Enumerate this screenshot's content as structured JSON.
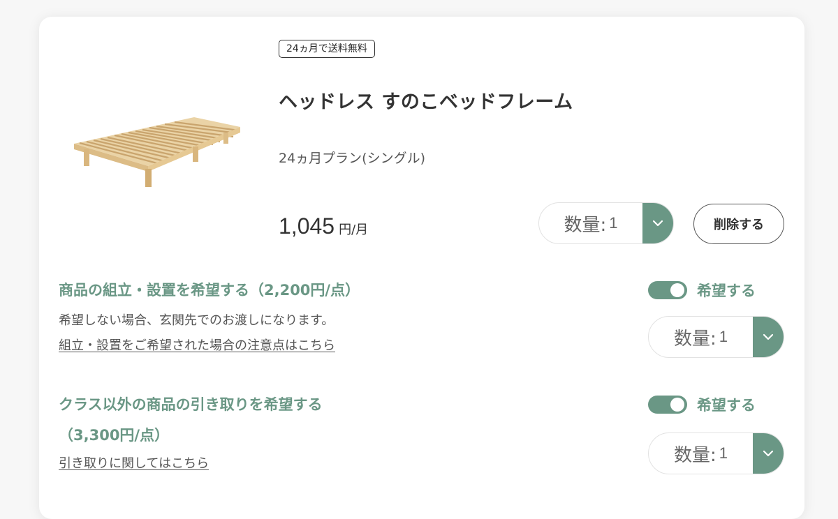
{
  "product": {
    "badge": "24ヵ月で送料無料",
    "name": "ヘッドレス すのこベッドフレーム",
    "plan": "24ヵ月プラン(シングル)",
    "price": "1,045",
    "price_unit": "円/月",
    "quantity_label": "数量:",
    "quantity_value": "1",
    "delete_label": "削除する"
  },
  "options": [
    {
      "title": "商品の組立・設置を希望する（2,200円/点）",
      "description": "希望しない場合、玄関先でのお渡しになります。",
      "link": "組立・設置をご希望された場合の注意点はこちら",
      "toggle_label": "希望する",
      "toggle_on": true,
      "quantity_label": "数量:",
      "quantity_value": "1"
    },
    {
      "title": "クラス以外の商品の引き取りを希望する",
      "title_line2": "（3,300円/点）",
      "link": "引き取りに関してはこちら",
      "toggle_label": "希望する",
      "toggle_on": true,
      "quantity_label": "数量:",
      "quantity_value": "1"
    }
  ],
  "colors": {
    "accent": "#6a9785",
    "text": "#333333",
    "muted": "#555555",
    "border": "#e2e2e2"
  },
  "icons": {
    "dropdown": "chevron-down-icon",
    "product_image": "bed-frame-image"
  }
}
